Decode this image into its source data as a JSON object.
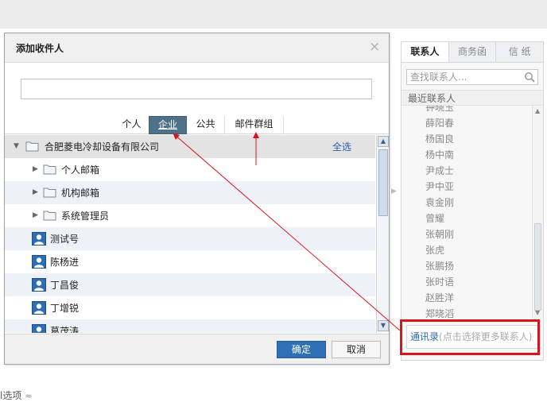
{
  "dialog": {
    "title": "添加收件人",
    "close_glyph": "×",
    "search_value": "",
    "tabs": [
      "个人",
      "企业",
      "公共",
      "邮件群组"
    ],
    "active_tab": "企业",
    "tree": {
      "root_label": "合肥菱电冷却设备有限公司",
      "select_all": "全选",
      "folders": [
        "个人邮箱",
        "机构邮箱",
        "系统管理员"
      ],
      "users": [
        "测试号",
        "陈杨进",
        "丁昌俊",
        "丁增锐",
        "葛茂涛"
      ]
    },
    "ok_label": "确定",
    "cancel_label": "取消"
  },
  "right_panel": {
    "tabs": [
      "联系人",
      "商务函",
      "信 纸"
    ],
    "active_tab": "联系人",
    "search_placeholder": "查找联系人...",
    "recent_header": "最近联系人",
    "contacts": [
      "钟晓玉",
      "薛阳春",
      "杨国良",
      "杨中南",
      "尹成士",
      "尹中亚",
      "袁金刚",
      "曾耀",
      "张朝刚",
      "张虎",
      "张鹏扬",
      "张时语",
      "赵胜洋",
      "郑晓滔"
    ],
    "address_book": "通讯录",
    "address_book_hint": "(点击选择更多联系人)"
  },
  "page": {
    "bottom_text": "l选项",
    "bottom_chevron": "≈"
  },
  "colors": {
    "active_tab_bg": "#4f7089",
    "ok_button": "#2f6fb3",
    "highlight_red": "#d9141c"
  },
  "icons": [
    "folder-icon",
    "user-icon",
    "search-icon",
    "close-icon",
    "expand-triangle-icon",
    "scroll-up-icon",
    "scroll-down-icon"
  ]
}
